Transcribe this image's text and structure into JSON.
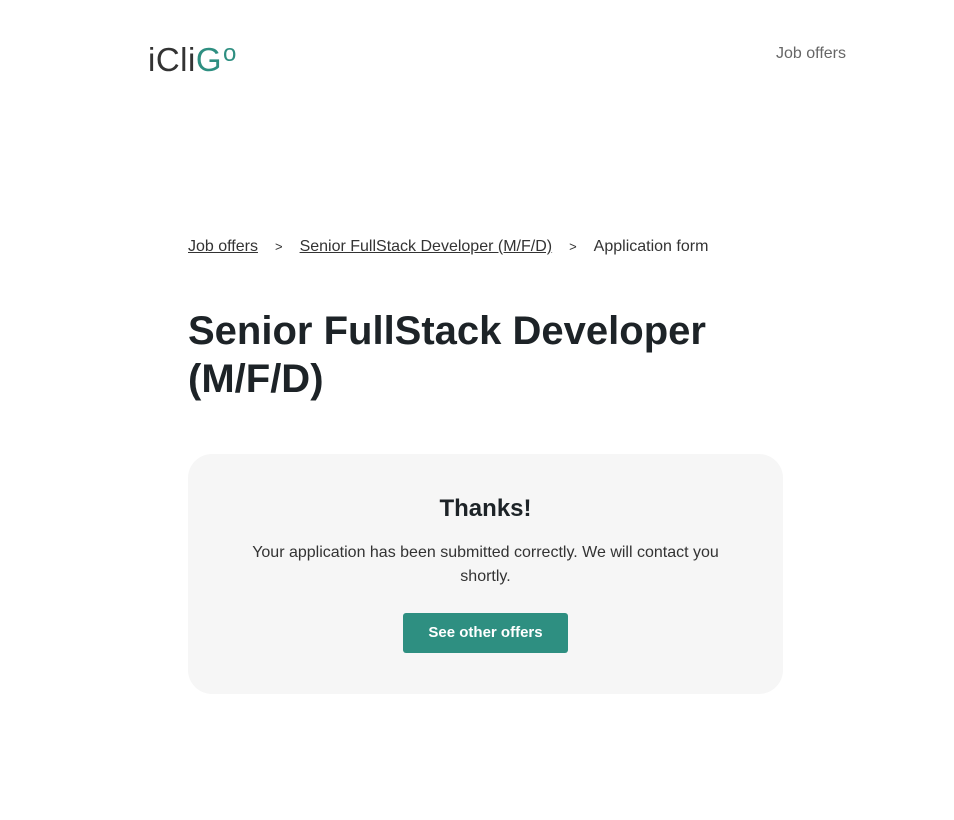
{
  "header": {
    "logo": {
      "part1": "iCli",
      "part2": "G",
      "part3": "o"
    },
    "nav_job_offers": "Job offers"
  },
  "breadcrumb": {
    "items": [
      {
        "label": "Job offers"
      },
      {
        "label": "Senior FullStack Developer (M/F/D)"
      },
      {
        "label": "Application form"
      }
    ],
    "separator": ">"
  },
  "page_title": "Senior FullStack Developer (M/F/D)",
  "confirmation": {
    "title": "Thanks!",
    "message": "Your application has been submitted correctly. We will contact you shortly.",
    "button_label": "See other offers"
  },
  "colors": {
    "accent": "#2e8f81",
    "card_background": "#f6f6f6",
    "text_dark": "#1d2327"
  }
}
